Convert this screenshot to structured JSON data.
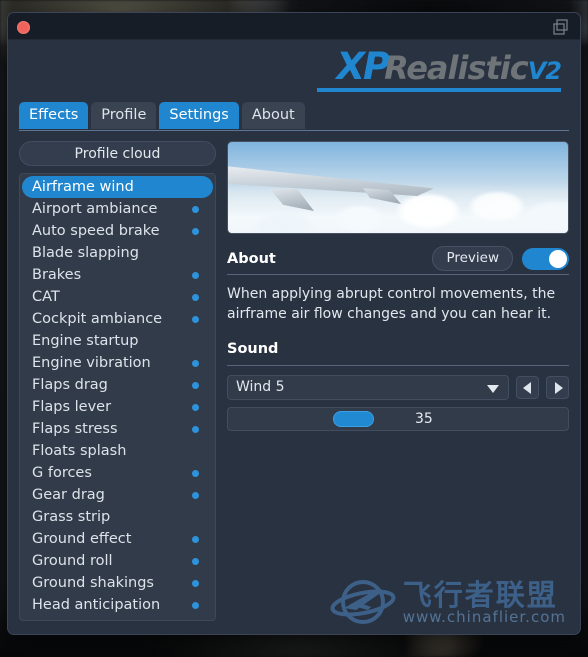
{
  "window": {
    "close_icon": "close-dot-icon",
    "restore_icon": "window-restore-icon"
  },
  "brand": {
    "xp": "XP",
    "realistic": "Realistic",
    "version": "V2",
    "accent_color": "#1f86cf"
  },
  "tabs": [
    {
      "label": "Effects",
      "state": "active"
    },
    {
      "label": "Profile",
      "state": "inactive"
    },
    {
      "label": "Settings",
      "state": "active"
    },
    {
      "label": "About",
      "state": "inactive"
    }
  ],
  "sidebar": {
    "profile_cloud_label": "Profile cloud",
    "items": [
      {
        "label": "Airframe wind",
        "selected": true,
        "dot": false
      },
      {
        "label": "Airport ambiance",
        "selected": false,
        "dot": true
      },
      {
        "label": "Auto speed brake",
        "selected": false,
        "dot": true
      },
      {
        "label": "Blade slapping",
        "selected": false,
        "dot": false
      },
      {
        "label": "Brakes",
        "selected": false,
        "dot": true
      },
      {
        "label": "CAT",
        "selected": false,
        "dot": true
      },
      {
        "label": "Cockpit ambiance",
        "selected": false,
        "dot": true
      },
      {
        "label": "Engine startup",
        "selected": false,
        "dot": false
      },
      {
        "label": "Engine vibration",
        "selected": false,
        "dot": true
      },
      {
        "label": "Flaps drag",
        "selected": false,
        "dot": true
      },
      {
        "label": "Flaps lever",
        "selected": false,
        "dot": true
      },
      {
        "label": "Flaps stress",
        "selected": false,
        "dot": true
      },
      {
        "label": "Floats splash",
        "selected": false,
        "dot": false
      },
      {
        "label": "G forces",
        "selected": false,
        "dot": true
      },
      {
        "label": "Gear drag",
        "selected": false,
        "dot": true
      },
      {
        "label": "Grass strip",
        "selected": false,
        "dot": false
      },
      {
        "label": "Ground effect",
        "selected": false,
        "dot": true
      },
      {
        "label": "Ground roll",
        "selected": false,
        "dot": true
      },
      {
        "label": "Ground shakings",
        "selected": false,
        "dot": true
      },
      {
        "label": "Head anticipation",
        "selected": false,
        "dot": true
      }
    ]
  },
  "detail": {
    "preview_image_alt": "airplane-wing-above-clouds",
    "about_title": "About",
    "preview_button_label": "Preview",
    "toggle_state": "on",
    "about_text": "When applying abrupt control movements, the airframe air flow changes and you can hear it.",
    "sound_title": "Sound",
    "sound_value": "Wind 5",
    "prev_icon": "triangle-left-icon",
    "next_icon": "triangle-right-icon",
    "dropdown_icon": "chevron-down-icon",
    "volume_value": "35",
    "volume_percent": 35
  },
  "watermark": {
    "cn": "飞行者联盟",
    "url": "www.chinaflier.com",
    "logo_icon": "globe-plane-icon"
  }
}
